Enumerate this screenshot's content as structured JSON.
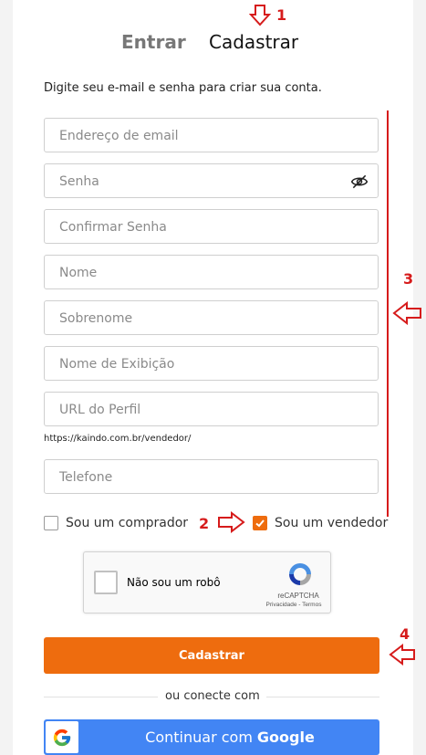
{
  "tabs": {
    "login": "Entrar",
    "register": "Cadastrar"
  },
  "instruction": "Digite seu e-mail e senha para criar sua conta.",
  "fields": {
    "email": "Endereço de email",
    "password": "Senha",
    "confirm_password": "Confirmar Senha",
    "first_name": "Nome",
    "last_name": "Sobrenome",
    "display_name": "Nome de Exibição",
    "profile_url": "URL do Perfil",
    "phone": "Telefone"
  },
  "profile_url_hint": "https://kaindo.com.br/vendedor/",
  "roles": {
    "buyer": {
      "label": "Sou um comprador",
      "checked": false
    },
    "seller": {
      "label": "Sou um vendedor",
      "checked": true
    }
  },
  "recaptcha": {
    "label": "Não sou um robô",
    "brand": "reCAPTCHA",
    "links": "Privacidade - Termos"
  },
  "submit_label": "Cadastrar",
  "divider_text": "ou conecte com",
  "google": {
    "prefix": "Continuar com",
    "brand": "Google"
  },
  "annotations": [
    "1",
    "2",
    "3",
    "4"
  ],
  "colors": {
    "accent": "#ee6c0e",
    "google_blue": "#4285f4",
    "annotation_red": "#d61b1b"
  }
}
